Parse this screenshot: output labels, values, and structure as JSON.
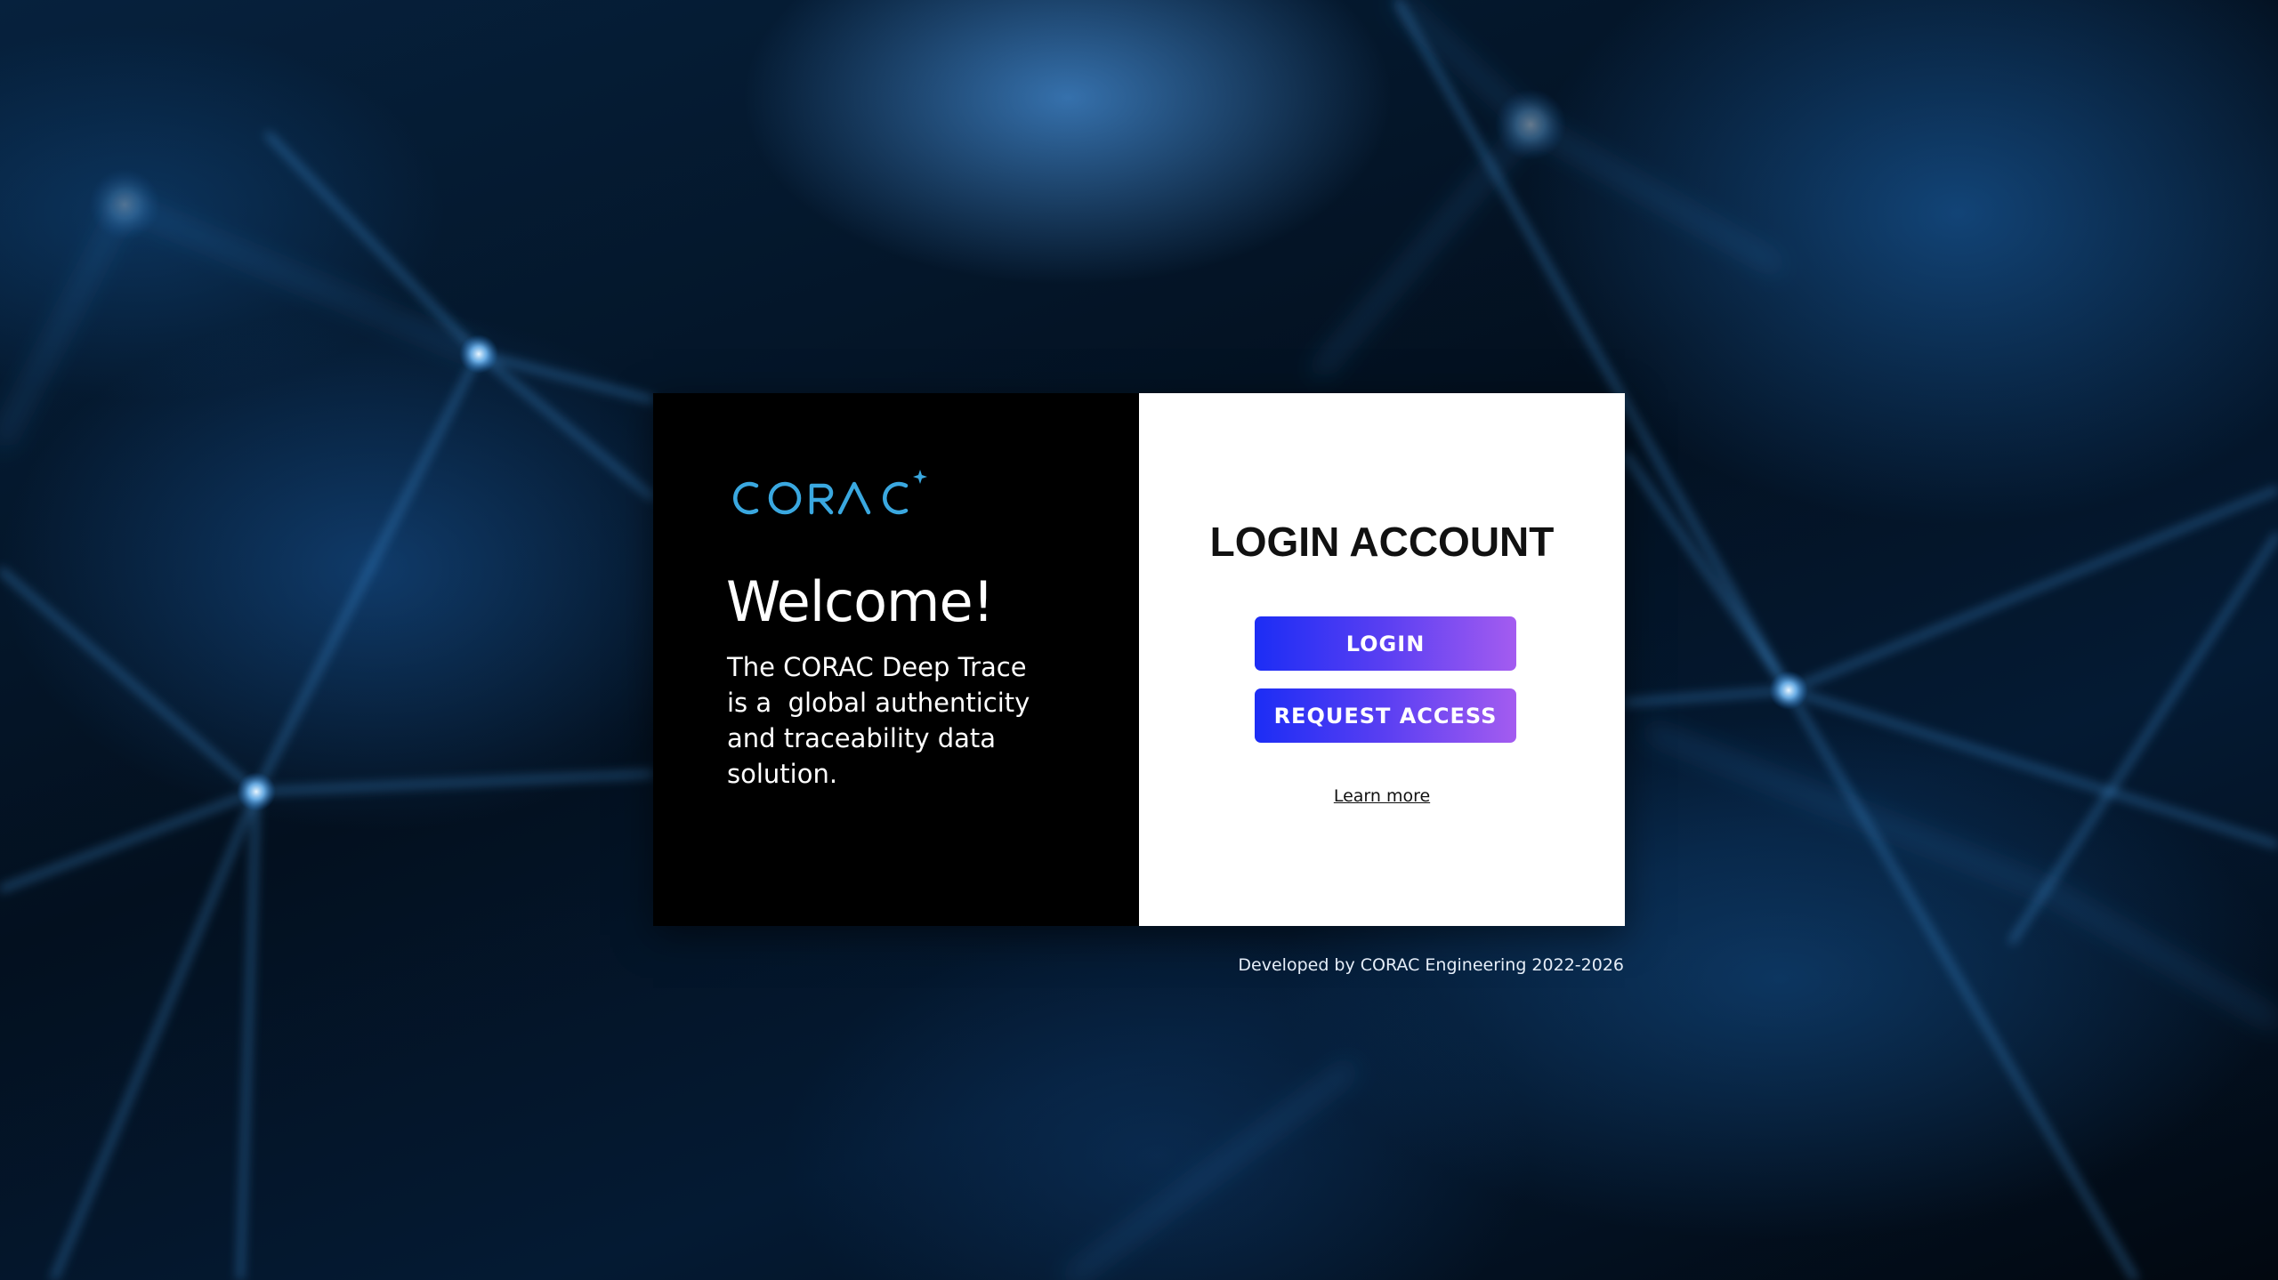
{
  "brand": {
    "logo_text": "CORAC",
    "logo_color": "#3aa8e0"
  },
  "welcome": {
    "title": "Welcome!",
    "description": "The CORAC Deep Trace\nis a  global authenticity\nand traceability data\nsolution."
  },
  "login_panel": {
    "heading": "LOGIN ACCOUNT",
    "login_label": "LOGIN",
    "request_access_label": "REQUEST ACCESS",
    "learn_more_label": "Learn more"
  },
  "footer": {
    "credit": "Developed by CORAC Engineering 2022-2026"
  },
  "colors": {
    "button_gradient_start": "#1c2df5",
    "button_gradient_end": "#a45cf0",
    "background_accent": "#3a8fe0"
  }
}
